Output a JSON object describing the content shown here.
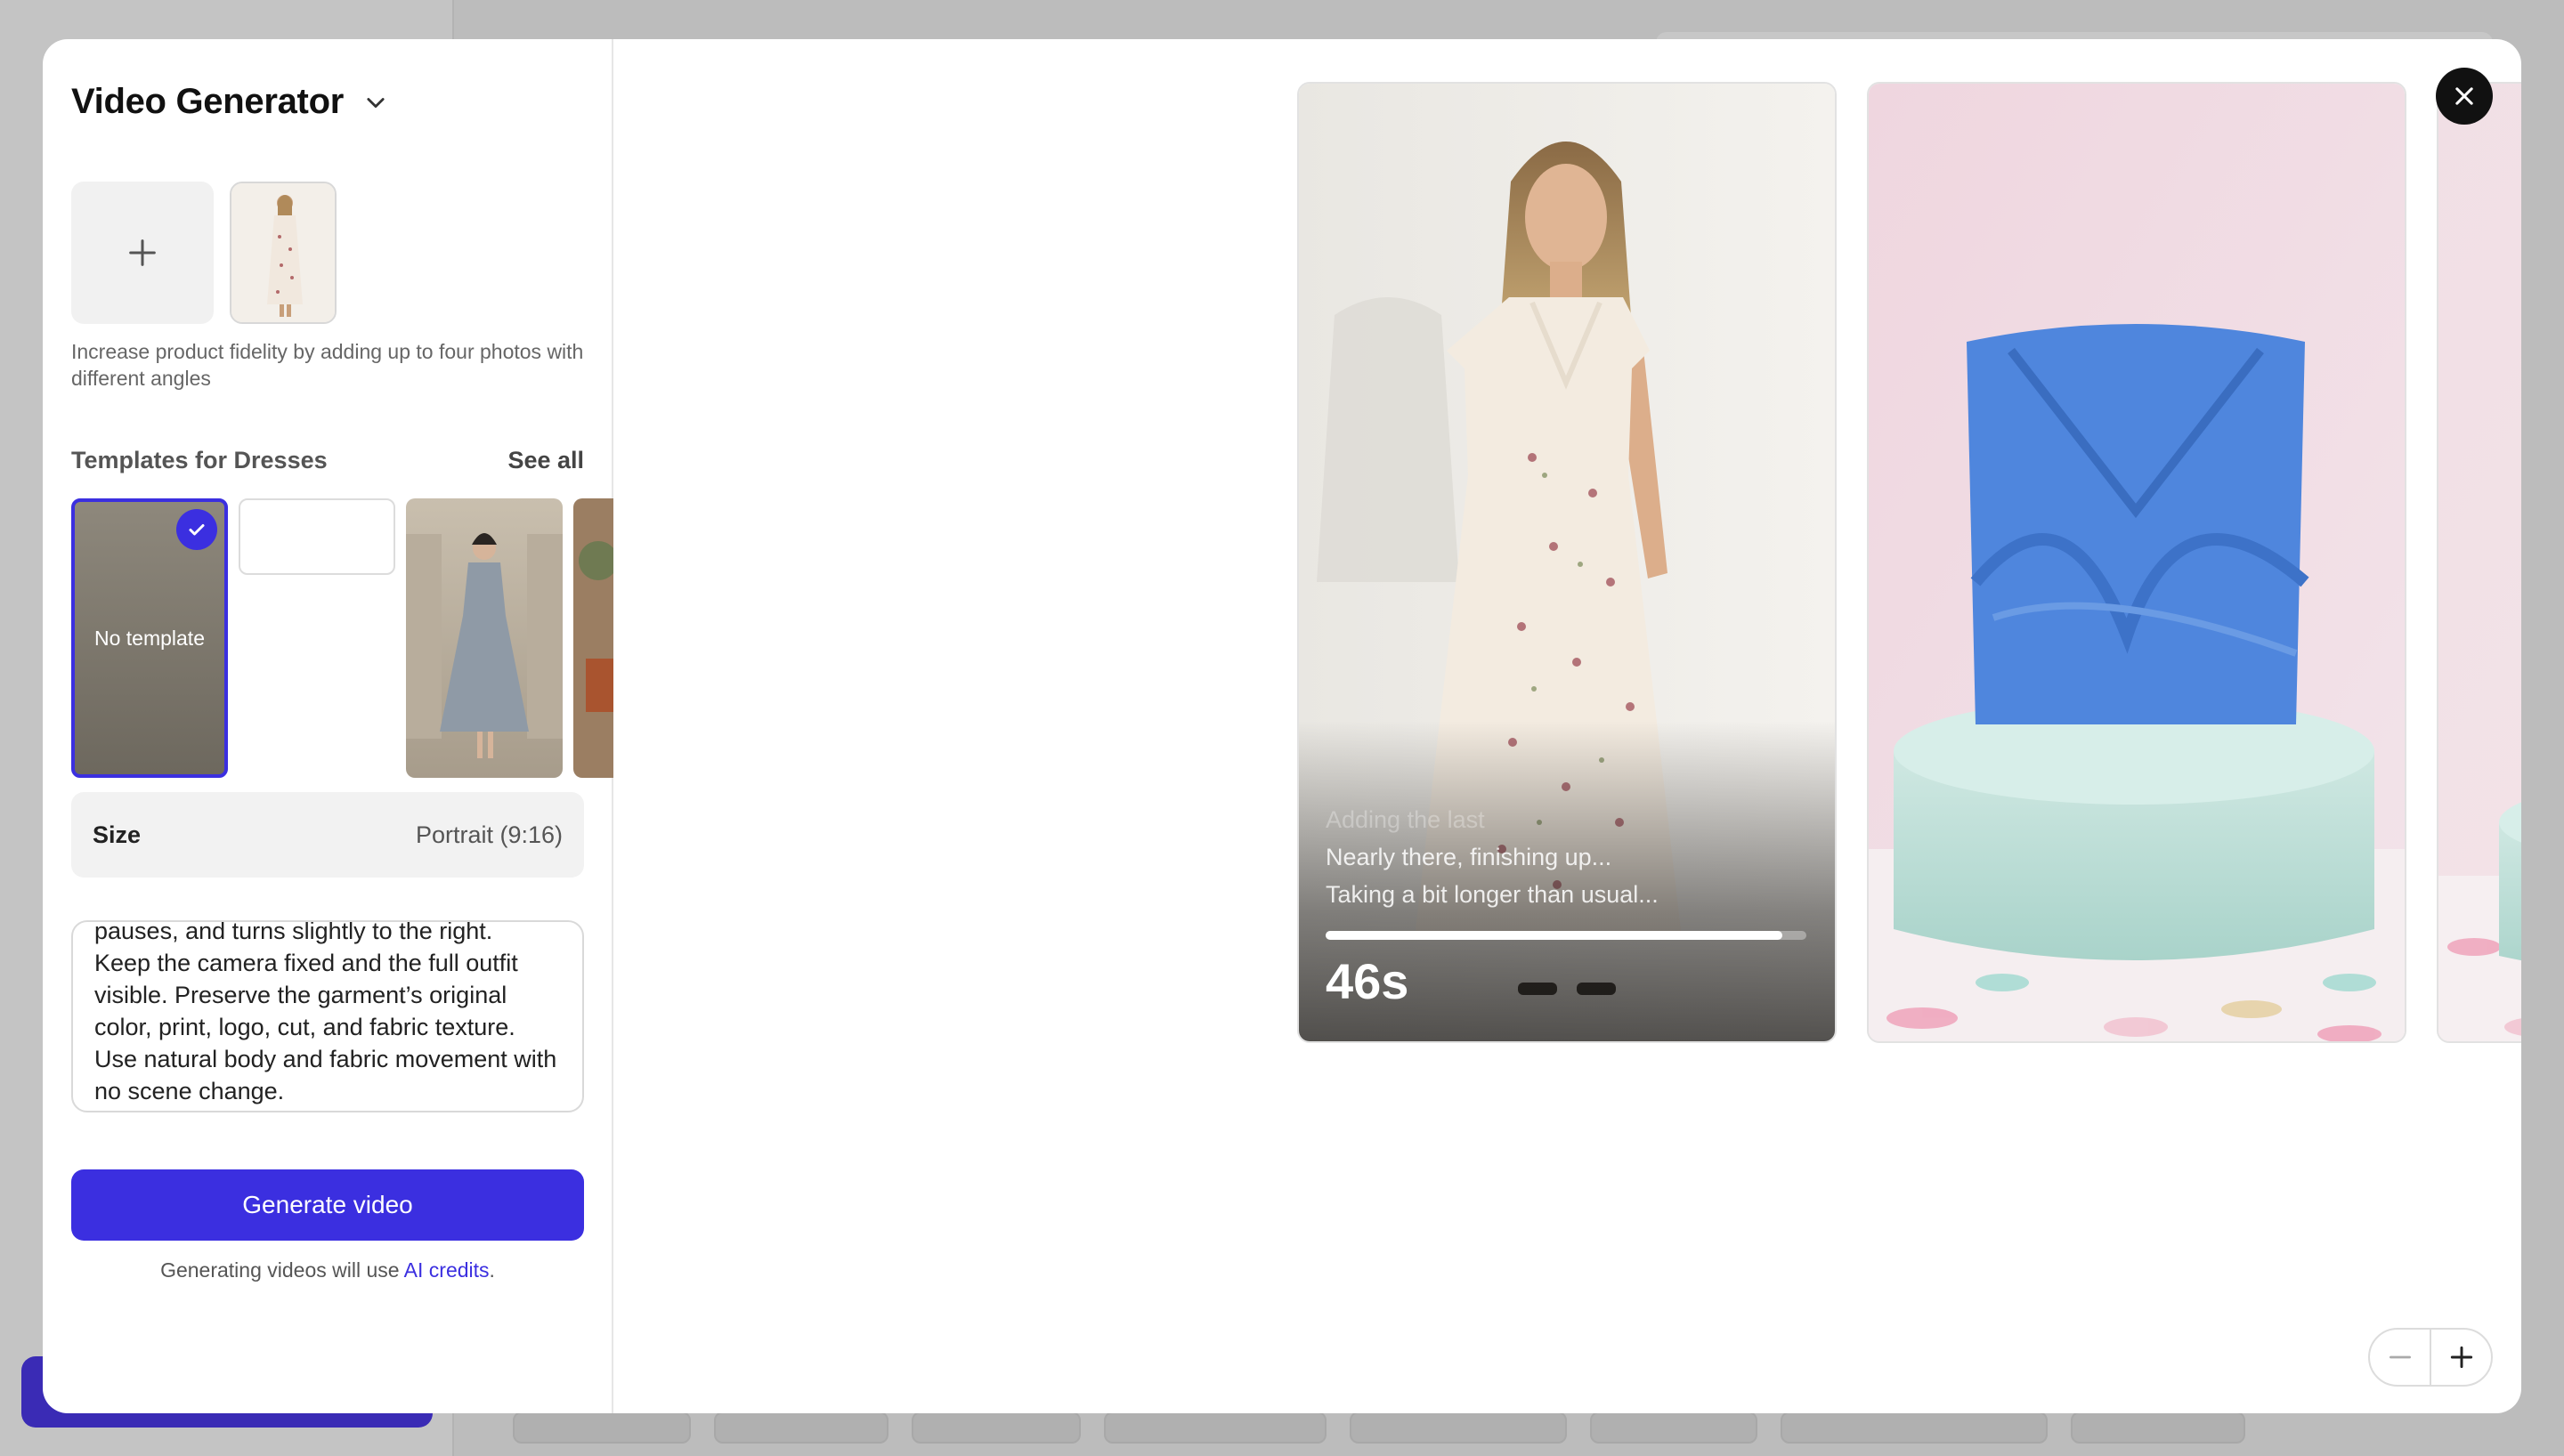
{
  "modal": {
    "title": "Video Generator",
    "upload_hint": "Increase product fidelity by adding up to four photos with different angles",
    "templates_title": "Templates for Dresses",
    "see_all_label": "See all",
    "templates": [
      {
        "label": "No template",
        "selected": true
      },
      {
        "label": "",
        "selected": false
      },
      {
        "label": "",
        "selected": false
      },
      {
        "label": "",
        "selected": false
      }
    ],
    "size_label": "Size",
    "size_value": "Portrait (9:16)",
    "prompt_text": "pauses, and turns slightly to the right.\nKeep the camera fixed and the full outfit visible. Preserve the garment’s original color, print, logo, cut, and fabric texture. Use natural body and fabric movement with no scene change.",
    "generate_label": "Generate video",
    "credits_prefix": "Generating videos will use ",
    "credits_link": "AI credits",
    "credits_suffix": "."
  },
  "gallery": {
    "generating": {
      "messages": [
        "Adding the last",
        "Nearly there, finishing up...",
        "Taking a bit longer than usual..."
      ],
      "progress": 0.95,
      "timer": "46s"
    }
  },
  "icons": {
    "add": "plus-icon",
    "close": "close-icon",
    "zoom_out": "minus-icon",
    "zoom_in": "plus-icon",
    "dropdown": "chevron-down-icon",
    "check": "check-icon"
  },
  "colors": {
    "accent": "#3b2fe0",
    "dress_blue": "#4f86dd",
    "pedestal": "#b9ddd6"
  }
}
